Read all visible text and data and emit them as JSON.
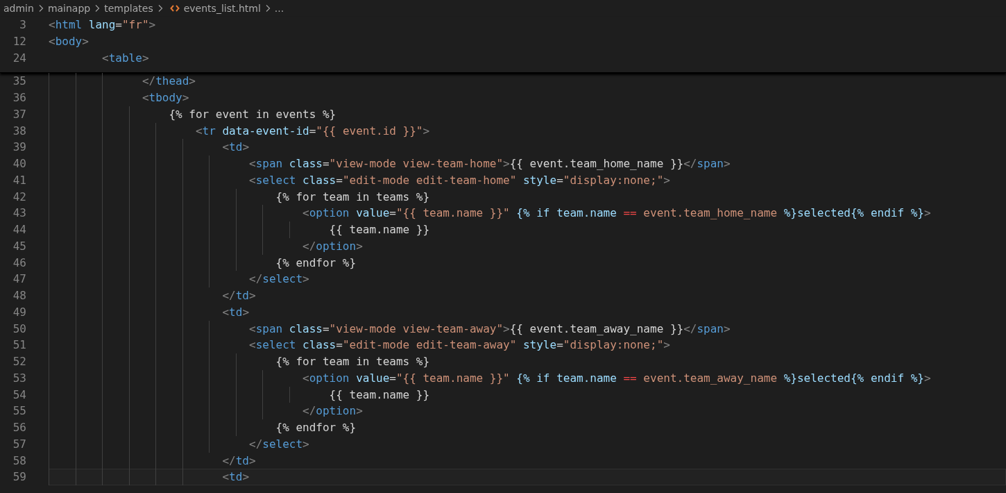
{
  "breadcrumb": [
    {
      "label": "admin",
      "kind": "folder"
    },
    {
      "label": "mainapp",
      "kind": "folder"
    },
    {
      "label": "templates",
      "kind": "folder"
    },
    {
      "label": "events_list.html",
      "kind": "file"
    },
    {
      "label": "...",
      "kind": "more"
    }
  ],
  "sticky_lines": [
    {
      "n": "3",
      "tokens": [
        {
          "text": "<",
          "kind": "p"
        },
        {
          "text": "html",
          "kind": "tag"
        },
        {
          "text": " lang",
          "kind": "attr"
        },
        {
          "text": "=",
          "kind": "txt"
        },
        {
          "text": "\"fr\"",
          "kind": "str"
        },
        {
          "text": ">",
          "kind": "p"
        }
      ]
    },
    {
      "n": "12",
      "tokens": [
        {
          "text": "<",
          "kind": "p"
        },
        {
          "text": "body",
          "kind": "tag"
        },
        {
          "text": ">",
          "kind": "p"
        }
      ]
    },
    {
      "n": "24",
      "tokens": [
        {
          "text": "        <",
          "kind": "p"
        },
        {
          "text": "table",
          "kind": "tag"
        },
        {
          "text": ">",
          "kind": "p"
        }
      ]
    }
  ],
  "lines": [
    {
      "n": "35",
      "current": false,
      "tokens": [
        {
          "text": "            </",
          "kind": "p"
        },
        {
          "text": "thead",
          "kind": "tag"
        },
        {
          "text": ">",
          "kind": "p"
        }
      ]
    },
    {
      "n": "36",
      "current": false,
      "tokens": [
        {
          "text": "            <",
          "kind": "p"
        },
        {
          "text": "tbody",
          "kind": "tag"
        },
        {
          "text": ">",
          "kind": "p"
        }
      ]
    },
    {
      "n": "37",
      "current": false,
      "tokens": [
        {
          "text": "                {% for event in events %}",
          "kind": "txt"
        }
      ]
    },
    {
      "n": "38",
      "current": false,
      "tokens": [
        {
          "text": "                    <",
          "kind": "p"
        },
        {
          "text": "tr",
          "kind": "tag"
        },
        {
          "text": " data-event-id",
          "kind": "attr"
        },
        {
          "text": "=",
          "kind": "txt"
        },
        {
          "text": "\"{{ event.id }}\"",
          "kind": "str"
        },
        {
          "text": ">",
          "kind": "p"
        }
      ]
    },
    {
      "n": "39",
      "current": false,
      "tokens": [
        {
          "text": "                        <",
          "kind": "p"
        },
        {
          "text": "td",
          "kind": "tag"
        },
        {
          "text": ">",
          "kind": "p"
        }
      ]
    },
    {
      "n": "40",
      "current": false,
      "tokens": [
        {
          "text": "                            <",
          "kind": "p"
        },
        {
          "text": "span",
          "kind": "tag"
        },
        {
          "text": " class",
          "kind": "attr"
        },
        {
          "text": "=",
          "kind": "txt"
        },
        {
          "text": "\"view-mode view-team-home\"",
          "kind": "str"
        },
        {
          "text": ">",
          "kind": "p"
        },
        {
          "text": "{{ event.team_home_name }}",
          "kind": "txt"
        },
        {
          "text": "</",
          "kind": "p"
        },
        {
          "text": "span",
          "kind": "tag"
        },
        {
          "text": ">",
          "kind": "p"
        }
      ]
    },
    {
      "n": "41",
      "current": false,
      "tokens": [
        {
          "text": "                            <",
          "kind": "p"
        },
        {
          "text": "select",
          "kind": "tag"
        },
        {
          "text": " class",
          "kind": "attr"
        },
        {
          "text": "=",
          "kind": "txt"
        },
        {
          "text": "\"edit-mode edit-team-home\"",
          "kind": "str"
        },
        {
          "text": " style",
          "kind": "attr"
        },
        {
          "text": "=",
          "kind": "txt"
        },
        {
          "text": "\"display:none;\"",
          "kind": "str"
        },
        {
          "text": ">",
          "kind": "p"
        }
      ]
    },
    {
      "n": "42",
      "current": false,
      "tokens": [
        {
          "text": "                                {% for team in teams %}",
          "kind": "txt"
        }
      ]
    },
    {
      "n": "43",
      "current": false,
      "tokens": [
        {
          "text": "                                    <",
          "kind": "p"
        },
        {
          "text": "option",
          "kind": "tag"
        },
        {
          "text": " value",
          "kind": "attr"
        },
        {
          "text": "=",
          "kind": "txt"
        },
        {
          "text": "\"{{ team.name }}\"",
          "kind": "str"
        },
        {
          "text": " {% if team.name ",
          "kind": "attr"
        },
        {
          "text": "==",
          "kind": "op"
        },
        {
          "text": " event.team_home_name ",
          "kind": "str"
        },
        {
          "text": "%}selected{% endif %}",
          "kind": "attr"
        },
        {
          "text": ">",
          "kind": "p"
        }
      ]
    },
    {
      "n": "44",
      "current": false,
      "tokens": [
        {
          "text": "                                        {{ team.name }}",
          "kind": "txt"
        }
      ]
    },
    {
      "n": "45",
      "current": false,
      "tokens": [
        {
          "text": "                                    </",
          "kind": "p"
        },
        {
          "text": "option",
          "kind": "tag"
        },
        {
          "text": ">",
          "kind": "p"
        }
      ]
    },
    {
      "n": "46",
      "current": false,
      "tokens": [
        {
          "text": "                                {% endfor %}",
          "kind": "txt"
        }
      ]
    },
    {
      "n": "47",
      "current": false,
      "tokens": [
        {
          "text": "                            </",
          "kind": "p"
        },
        {
          "text": "select",
          "kind": "tag"
        },
        {
          "text": ">",
          "kind": "p"
        }
      ]
    },
    {
      "n": "48",
      "current": false,
      "tokens": [
        {
          "text": "                        </",
          "kind": "p"
        },
        {
          "text": "td",
          "kind": "tag"
        },
        {
          "text": ">",
          "kind": "p"
        }
      ]
    },
    {
      "n": "49",
      "current": false,
      "tokens": [
        {
          "text": "                        <",
          "kind": "p"
        },
        {
          "text": "td",
          "kind": "tag"
        },
        {
          "text": ">",
          "kind": "p"
        }
      ]
    },
    {
      "n": "50",
      "current": false,
      "tokens": [
        {
          "text": "                            <",
          "kind": "p"
        },
        {
          "text": "span",
          "kind": "tag"
        },
        {
          "text": " class",
          "kind": "attr"
        },
        {
          "text": "=",
          "kind": "txt"
        },
        {
          "text": "\"view-mode view-team-away\"",
          "kind": "str"
        },
        {
          "text": ">",
          "kind": "p"
        },
        {
          "text": "{{ event.team_away_name }}",
          "kind": "txt"
        },
        {
          "text": "</",
          "kind": "p"
        },
        {
          "text": "span",
          "kind": "tag"
        },
        {
          "text": ">",
          "kind": "p"
        }
      ]
    },
    {
      "n": "51",
      "current": false,
      "tokens": [
        {
          "text": "                            <",
          "kind": "p"
        },
        {
          "text": "select",
          "kind": "tag"
        },
        {
          "text": " class",
          "kind": "attr"
        },
        {
          "text": "=",
          "kind": "txt"
        },
        {
          "text": "\"edit-mode edit-team-away\"",
          "kind": "str"
        },
        {
          "text": " style",
          "kind": "attr"
        },
        {
          "text": "=",
          "kind": "txt"
        },
        {
          "text": "\"display:none;\"",
          "kind": "str"
        },
        {
          "text": ">",
          "kind": "p"
        }
      ]
    },
    {
      "n": "52",
      "current": false,
      "tokens": [
        {
          "text": "                                {% for team in teams %}",
          "kind": "txt"
        }
      ]
    },
    {
      "n": "53",
      "current": false,
      "tokens": [
        {
          "text": "                                    <",
          "kind": "p"
        },
        {
          "text": "option",
          "kind": "tag"
        },
        {
          "text": " value",
          "kind": "attr"
        },
        {
          "text": "=",
          "kind": "txt"
        },
        {
          "text": "\"{{ team.name }}\"",
          "kind": "str"
        },
        {
          "text": " {% if team.name ",
          "kind": "attr"
        },
        {
          "text": "==",
          "kind": "op"
        },
        {
          "text": " event.team_away_name ",
          "kind": "str"
        },
        {
          "text": "%}selected{% endif %}",
          "kind": "attr"
        },
        {
          "text": ">",
          "kind": "p"
        }
      ]
    },
    {
      "n": "54",
      "current": false,
      "tokens": [
        {
          "text": "                                        {{ team.name }}",
          "kind": "txt"
        }
      ]
    },
    {
      "n": "55",
      "current": false,
      "tokens": [
        {
          "text": "                                    </",
          "kind": "p"
        },
        {
          "text": "option",
          "kind": "tag"
        },
        {
          "text": ">",
          "kind": "p"
        }
      ]
    },
    {
      "n": "56",
      "current": false,
      "tokens": [
        {
          "text": "                                {% endfor %}",
          "kind": "txt"
        }
      ]
    },
    {
      "n": "57",
      "current": false,
      "tokens": [
        {
          "text": "                            </",
          "kind": "p"
        },
        {
          "text": "select",
          "kind": "tag"
        },
        {
          "text": ">",
          "kind": "p"
        }
      ]
    },
    {
      "n": "58",
      "current": false,
      "tokens": [
        {
          "text": "                        </",
          "kind": "p"
        },
        {
          "text": "td",
          "kind": "tag"
        },
        {
          "text": ">",
          "kind": "p"
        }
      ]
    },
    {
      "n": "59",
      "current": true,
      "tokens": [
        {
          "text": "                        <",
          "kind": "p"
        },
        {
          "text": "td",
          "kind": "tag"
        },
        {
          "text": ">",
          "kind": "p"
        }
      ]
    }
  ]
}
